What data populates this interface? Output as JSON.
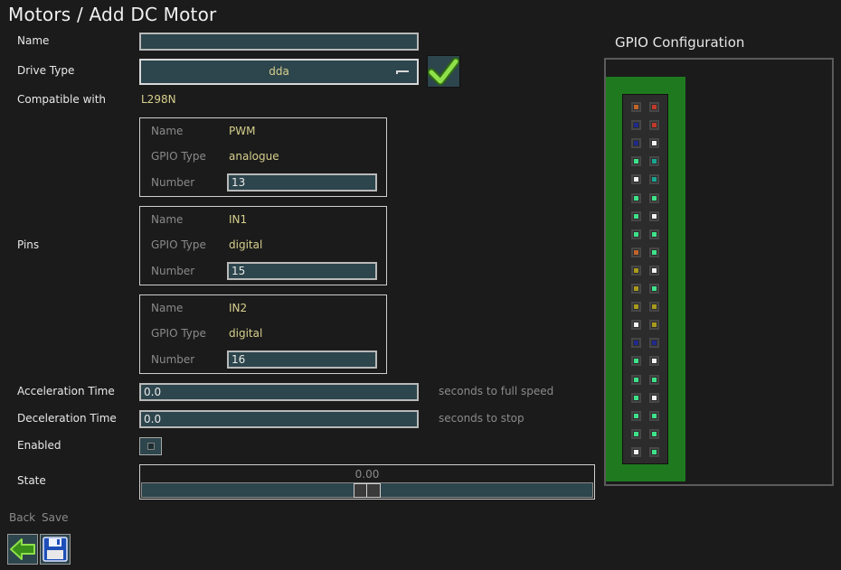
{
  "page": {
    "title": "Motors / Add DC Motor"
  },
  "form": {
    "name_label": "Name",
    "name_value": "",
    "drive_type_label": "Drive Type",
    "drive_type_value": "dda",
    "compatible_label": "Compatible with",
    "compatible_value": "L298N",
    "pins_label": "Pins",
    "pins": [
      {
        "name_label": "Name",
        "name": "PWM",
        "type_label": "GPIO Type",
        "type": "analogue",
        "number_label": "Number",
        "number": "13"
      },
      {
        "name_label": "Name",
        "name": "IN1",
        "type_label": "GPIO Type",
        "type": "digital",
        "number_label": "Number",
        "number": "15"
      },
      {
        "name_label": "Name",
        "name": "IN2",
        "type_label": "GPIO Type",
        "type": "digital",
        "number_label": "Number",
        "number": "16"
      }
    ],
    "accel_label": "Acceleration Time",
    "accel_value": "0.0",
    "accel_unit": "seconds to full speed",
    "decel_label": "Deceleration Time",
    "decel_value": "0.0",
    "decel_unit": "seconds to stop",
    "enabled_label": "Enabled",
    "enabled": false,
    "state_label": "State",
    "state_value": "0.00",
    "state_fraction": 0.5
  },
  "gpio": {
    "title": "GPIO Configuration",
    "pin_colors": {
      "orange": "#c0652b",
      "red": "#c0392b",
      "navy": "#1f2a8a",
      "white": "#f2f2f2",
      "teal": "#1aa592",
      "green": "#3fe28a",
      "olive": "#a89a1c"
    },
    "rows": [
      [
        "orange",
        "red"
      ],
      [
        "navy",
        "red"
      ],
      [
        "navy",
        "white"
      ],
      [
        "green",
        "teal"
      ],
      [
        "white",
        "teal"
      ],
      [
        "green",
        "green"
      ],
      [
        "green",
        "white"
      ],
      [
        "green",
        "green"
      ],
      [
        "orange",
        "green"
      ],
      [
        "olive",
        "white"
      ],
      [
        "olive",
        "green"
      ],
      [
        "olive",
        "olive"
      ],
      [
        "white",
        "olive"
      ],
      [
        "navy",
        "navy"
      ],
      [
        "green",
        "white"
      ],
      [
        "green",
        "green"
      ],
      [
        "green",
        "white"
      ],
      [
        "green",
        "green"
      ],
      [
        "green",
        "green"
      ],
      [
        "white",
        "green"
      ]
    ]
  },
  "nav": {
    "back_label": "Back",
    "save_label": "Save",
    "back_icon": "arrow-left-icon",
    "save_icon": "floppy-disk-icon"
  },
  "colors": {
    "background": "#1b1b1b",
    "field": "#2d454c",
    "accent_text": "#d6cf8c",
    "pcb": "#1f7a1f"
  }
}
